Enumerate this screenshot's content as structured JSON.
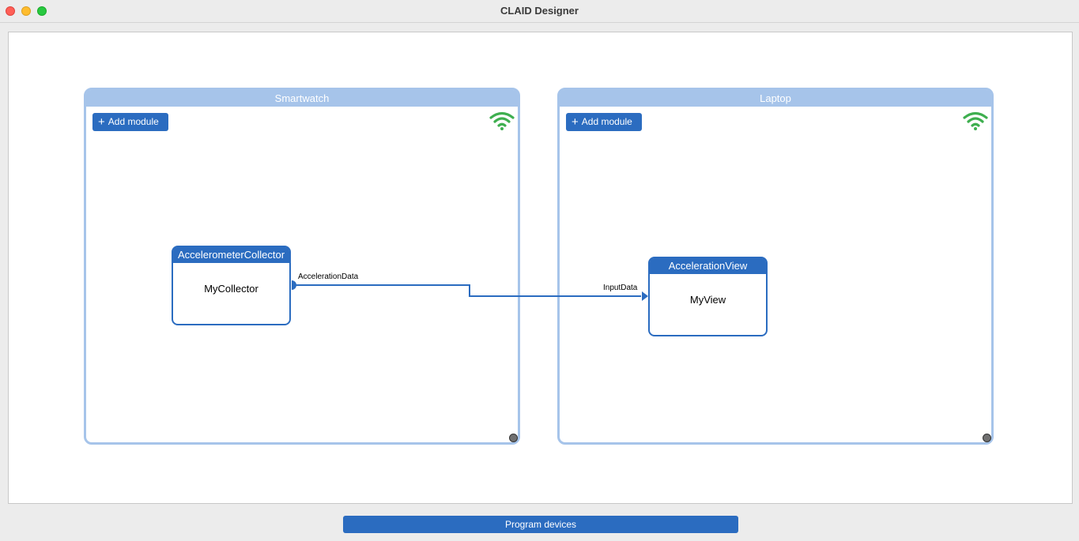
{
  "window": {
    "title": "CLAID Designer"
  },
  "devices": [
    {
      "name": "Smartwatch",
      "add_label": "Add module"
    },
    {
      "name": "Laptop",
      "add_label": "Add module"
    }
  ],
  "modules": [
    {
      "type": "AccelerometerCollector",
      "name": "MyCollector",
      "output_port": "AccelerationData"
    },
    {
      "type": "AccelerationView",
      "name": "MyView",
      "input_port": "InputData"
    }
  ],
  "footer": {
    "program_label": "Program devices"
  },
  "colors": {
    "accent": "#2b6cc0",
    "device_border": "#a6c4ea",
    "wifi": "#3eaf4f"
  },
  "icons": {
    "add": "plus-icon",
    "connection": "wifi-icon"
  }
}
